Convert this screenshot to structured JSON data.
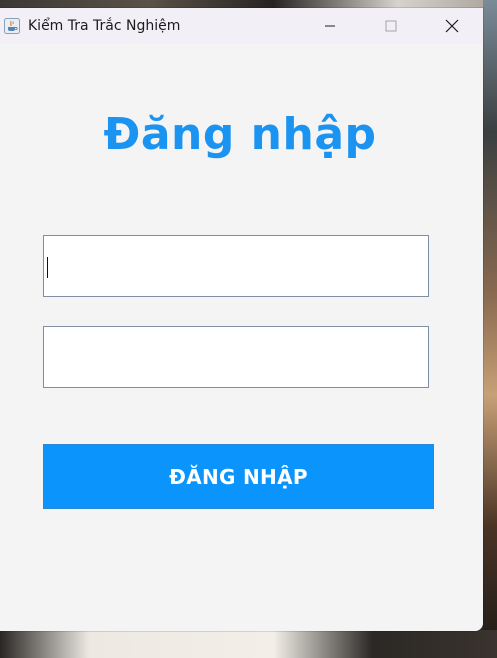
{
  "window": {
    "title": "Kiểm Tra Trắc Nghiệm",
    "app_icon": "java-cup-icon",
    "controls": {
      "minimize_icon": "minimize-icon",
      "maximize_icon": "maximize-icon",
      "close_icon": "close-icon"
    }
  },
  "login": {
    "heading": "Đăng nhập",
    "username": {
      "value": "",
      "placeholder": ""
    },
    "password": {
      "value": "",
      "placeholder": ""
    },
    "submit_label": "ĐĂNG NHẬP"
  },
  "colors": {
    "accent": "#1b93f0",
    "button": "#0b94fb",
    "background": "#f4f4f5",
    "titlebar": "#f2eff6"
  }
}
